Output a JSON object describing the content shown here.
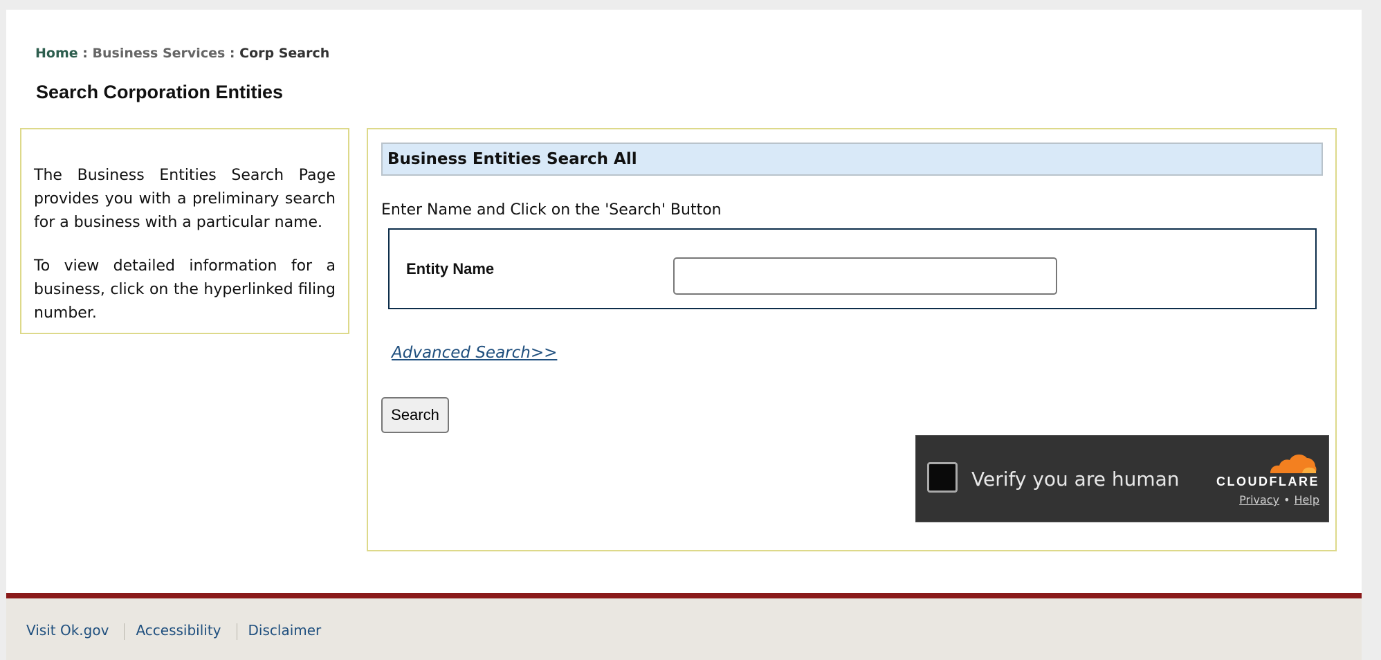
{
  "breadcrumb": {
    "home": "Home",
    "separator": ":",
    "business_services": "Business Services",
    "current": "Corp Search"
  },
  "page_title": "Search Corporation Entities",
  "info": {
    "paragraph_1": "The Business Entities Search Page provides you with a preliminary search for a business with a particular name.",
    "paragraph_2": "To view detailed information for a business, click on the hyperlinked filing number."
  },
  "search_panel": {
    "header": "Business Entities Search All",
    "instructions": "Enter Name and Click on the 'Search' Button",
    "entity_name_label": "Entity Name",
    "entity_name_value": "",
    "advanced_search_link": "Advanced Search>>",
    "search_button": "Search"
  },
  "captcha": {
    "label": "Verify you are human",
    "brand": "CLOUDFLARE",
    "privacy": "Privacy",
    "dot": "•",
    "help": "Help",
    "cloud_color": "#f38020",
    "icon": "cloudflare-cloud-icon"
  },
  "footer": {
    "links": [
      "Visit Ok.gov",
      "Accessibility",
      "Disclaimer"
    ],
    "bar_color": "#8a1a1a"
  }
}
